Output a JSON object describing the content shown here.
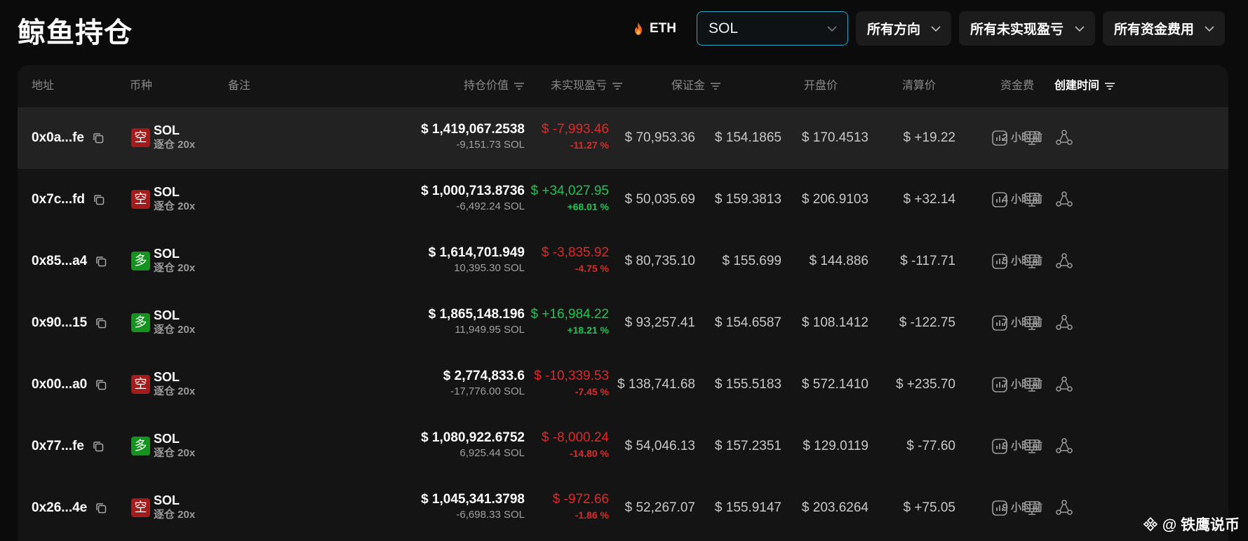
{
  "page": {
    "title": "鲸鱼持仓"
  },
  "filters": {
    "eth_label": "ETH",
    "coin_select": "SOL",
    "direction_select": "所有方向",
    "pnl_select": "所有未实现盈亏",
    "funding_select": "所有资金费用"
  },
  "table": {
    "headers": {
      "address": "地址",
      "coin": "币种",
      "note": "备注",
      "position_value": "持仓价值",
      "unrealized_pnl": "未实现盈亏",
      "margin": "保证金",
      "entry_price": "开盘价",
      "liq_price": "清算价",
      "funding": "资金费",
      "created": "创建时间"
    },
    "rows": [
      {
        "address": "0x0a...fe",
        "side": "空",
        "side_type": "short",
        "coin": "SOL",
        "leverage": "逐仓 20x",
        "value": "$ 1,419,067.2538",
        "size": "-9,151.73 SOL",
        "pnl": "$ -7,993.46",
        "pnl_pct": "-11.27 %",
        "pnl_sign": "neg",
        "margin": "$ 70,953.36",
        "entry": "$ 154.1865",
        "liq": "$ 170.4513",
        "funding": "$ +19.22",
        "funding_sign": "pos",
        "time": "2 小时前"
      },
      {
        "address": "0x7c...fd",
        "side": "空",
        "side_type": "short",
        "coin": "SOL",
        "leverage": "逐仓 20x",
        "value": "$ 1,000,713.8736",
        "size": "-6,492.24 SOL",
        "pnl": "$ +34,027.95",
        "pnl_pct": "+68.01 %",
        "pnl_sign": "pos",
        "margin": "$ 50,035.69",
        "entry": "$ 159.3813",
        "liq": "$ 206.9103",
        "funding": "$ +32.14",
        "funding_sign": "pos",
        "time": "4 小时前"
      },
      {
        "address": "0x85...a4",
        "side": "多",
        "side_type": "long",
        "coin": "SOL",
        "leverage": "逐仓 20x",
        "value": "$ 1,614,701.949",
        "size": "10,395.30 SOL",
        "pnl": "$ -3,835.92",
        "pnl_pct": "-4.75 %",
        "pnl_sign": "neg",
        "margin": "$ 80,735.10",
        "entry": "$ 155.699",
        "liq": "$ 144.886",
        "funding": "$ -117.71",
        "funding_sign": "neg",
        "time": "5 小时前"
      },
      {
        "address": "0x90...15",
        "side": "多",
        "side_type": "long",
        "coin": "SOL",
        "leverage": "逐仓 20x",
        "value": "$ 1,865,148.196",
        "size": "11,949.95 SOL",
        "pnl": "$ +16,984.22",
        "pnl_pct": "+18.21 %",
        "pnl_sign": "pos",
        "margin": "$ 93,257.41",
        "entry": "$ 154.6587",
        "liq": "$ 108.1412",
        "funding": "$ -122.75",
        "funding_sign": "neg",
        "time": "7 小时前"
      },
      {
        "address": "0x00...a0",
        "side": "空",
        "side_type": "short",
        "coin": "SOL",
        "leverage": "逐仓 20x",
        "value": "$ 2,774,833.6",
        "size": "-17,776.00 SOL",
        "pnl": "$ -10,339.53",
        "pnl_pct": "-7.45 %",
        "pnl_sign": "neg",
        "margin": "$ 138,741.68",
        "entry": "$ 155.5183",
        "liq": "$ 572.1410",
        "funding": "$ +235.70",
        "funding_sign": "pos",
        "time": "7 小时前"
      },
      {
        "address": "0x77...fe",
        "side": "多",
        "side_type": "long",
        "coin": "SOL",
        "leverage": "逐仓 20x",
        "value": "$ 1,080,922.6752",
        "size": "6,925.44 SOL",
        "pnl": "$ -8,000.24",
        "pnl_pct": "-14.80 %",
        "pnl_sign": "neg",
        "margin": "$ 54,046.13",
        "entry": "$ 157.2351",
        "liq": "$ 129.0119",
        "funding": "$ -77.60",
        "funding_sign": "neg",
        "time": "9 小时前"
      },
      {
        "address": "0x26...4e",
        "side": "空",
        "side_type": "short",
        "coin": "SOL",
        "leverage": "逐仓 20x",
        "value": "$ 1,045,341.3798",
        "size": "-6,698.33 SOL",
        "pnl": "$ -972.66",
        "pnl_pct": "-1.86 %",
        "pnl_sign": "neg",
        "margin": "$ 52,267.07",
        "entry": "$ 155.9147",
        "liq": "$ 203.6264",
        "funding": "$ +75.05",
        "funding_sign": "pos",
        "time": "9 小时前"
      }
    ]
  },
  "watermark": {
    "text": "@ 铁鹰说币"
  },
  "colors": {
    "positive": "#1cc453",
    "negative": "#e02828",
    "short_badge": "#a31b1b",
    "long_badge": "#15931f",
    "accent_border": "#2aa5c6"
  },
  "icons": {
    "row_actions": [
      "chart-icon",
      "monitor-icon",
      "share-icon"
    ],
    "copy": "copy-icon",
    "eth": "flame-icon",
    "sort": "sort-icon"
  }
}
